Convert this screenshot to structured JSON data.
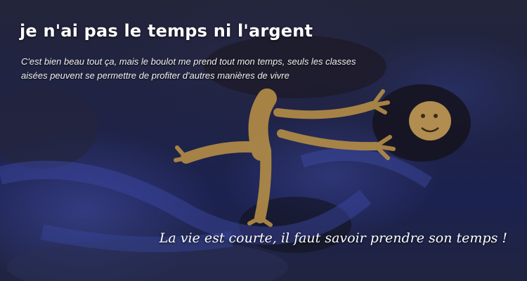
{
  "slide": {
    "title": "je n'ai pas le temps ni l'argent",
    "subtitle": "C'est bien beau tout ça, mais le boulot me prend tout mon temps, seuls les classes aisées peuvent se permettre de profiter d'autres manières de vivre",
    "quote": "La vie est courte, il faut savoir prendre son temps !"
  },
  "background": {
    "description_icon": "child-drawing-figure-icon",
    "colors": {
      "paint_dark": "#1c1f3a",
      "paint_blue": "#3a4596",
      "figure_ochre": "#b08a45",
      "text": "#ffffff"
    }
  }
}
